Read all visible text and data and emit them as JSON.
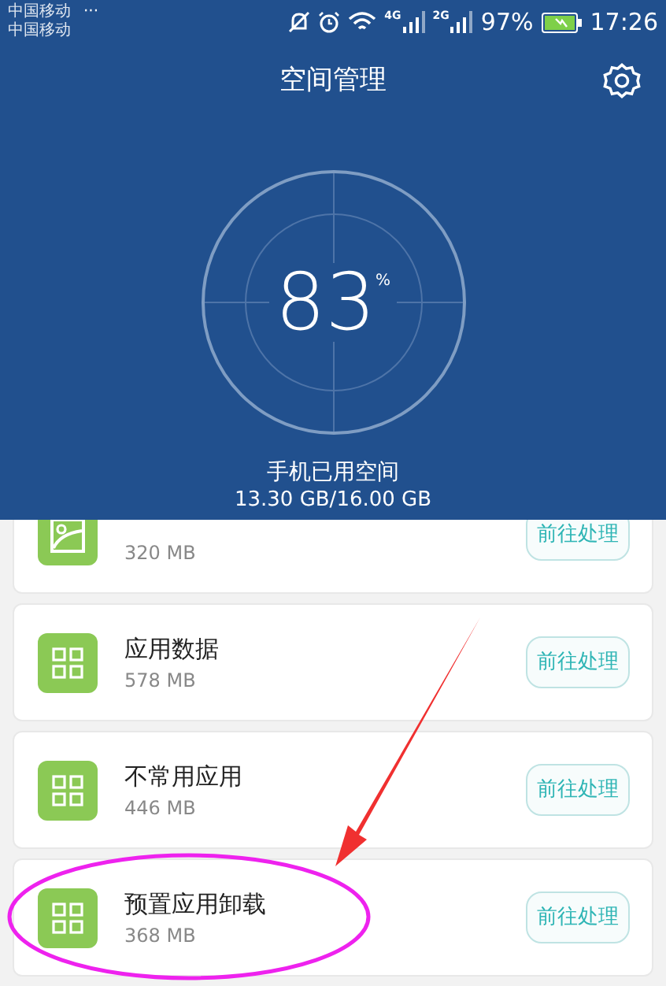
{
  "status_bar": {
    "carriers": [
      "中国移动",
      "中国移动"
    ],
    "more": "···",
    "network_1": "4G",
    "network_2": "2G",
    "battery": "97%",
    "time": "17:26"
  },
  "header": {
    "title": "空间管理"
  },
  "usage": {
    "percent": "83",
    "unit": "%",
    "label": "手机已用空间",
    "amount": "13.30 GB/16.00 GB"
  },
  "items": [
    {
      "kind": "image",
      "size": "320 MB",
      "action": "前往处理"
    },
    {
      "kind": "apps",
      "name": "应用数据",
      "size": "578 MB",
      "action": "前往处理"
    },
    {
      "kind": "apps",
      "name": "不常用应用",
      "size": "446 MB",
      "action": "前往处理"
    },
    {
      "kind": "apps",
      "name": "预置应用卸载",
      "size": "368 MB",
      "action": "前往处理"
    }
  ]
}
